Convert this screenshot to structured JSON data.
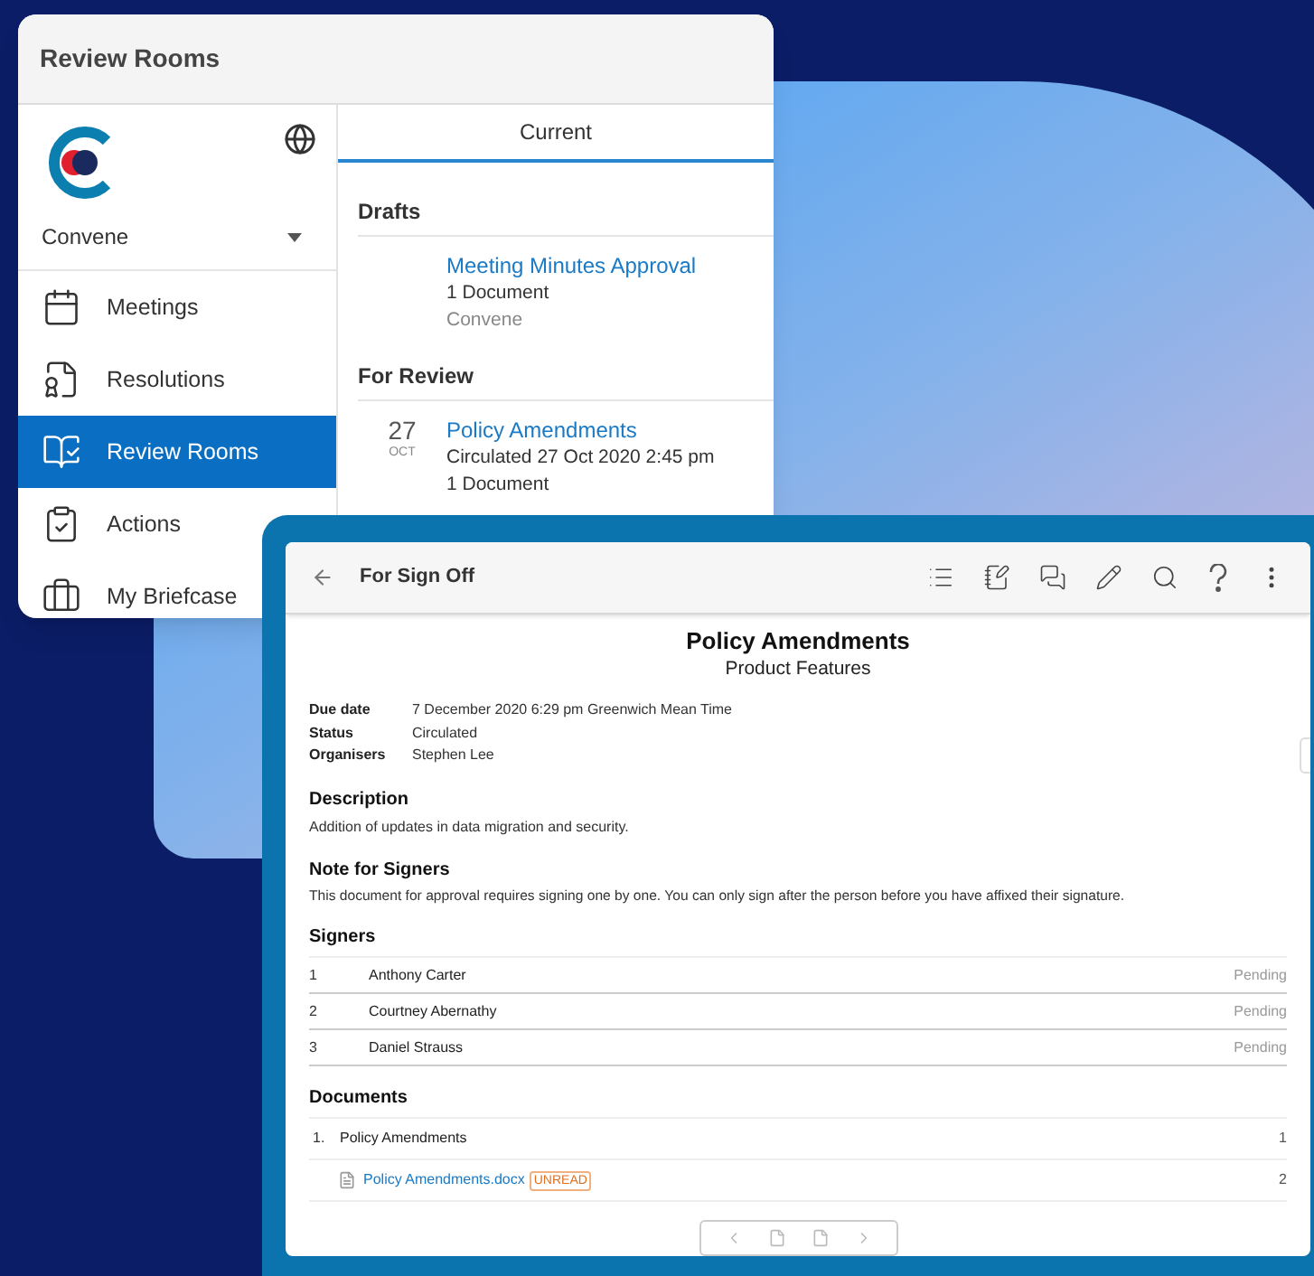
{
  "review_window": {
    "title": "Review Rooms",
    "org": "Convene",
    "nav": [
      {
        "label": "Meetings",
        "selected": false
      },
      {
        "label": "Resolutions",
        "selected": false
      },
      {
        "label": "Review Rooms",
        "selected": true
      },
      {
        "label": "Actions",
        "selected": false
      },
      {
        "label": "My Briefcase",
        "selected": false
      }
    ],
    "tabs": [
      {
        "label": "Current",
        "selected": true
      }
    ],
    "sections": [
      {
        "heading": "Drafts",
        "items": [
          {
            "title": "Meeting Minutes Approval",
            "lines": [
              {
                "text": "1 Document",
                "kind": "detail"
              },
              {
                "text": "Convene",
                "kind": "muted"
              }
            ]
          }
        ]
      },
      {
        "heading": "For Review",
        "items": [
          {
            "day": "27",
            "month": "OCT",
            "title": "Policy Amendments",
            "lines": [
              {
                "text": "Circulated 27 Oct 2020 2:45 pm",
                "kind": "detail"
              },
              {
                "text": "1 Document",
                "kind": "detail"
              }
            ]
          }
        ]
      }
    ]
  },
  "sign_off_window": {
    "title": "For Sign Off",
    "doc_title": "Policy Amendments",
    "doc_subtitle": "Product Features",
    "meta": [
      {
        "label": "Due date",
        "value": "7 December 2020 6:29 pm Greenwich Mean Time"
      },
      {
        "label": "Status",
        "value": "Circulated"
      },
      {
        "label": "Organisers",
        "value": "Stephen Lee"
      }
    ],
    "description": {
      "heading": "Description",
      "text": "Addition of updates in data migration and security."
    },
    "note": {
      "heading": "Note for Signers",
      "text": "This document for approval requires signing one by one. You can only sign after the person before you have affixed their signature."
    },
    "signers": {
      "heading": "Signers",
      "rows": [
        {
          "number": "1",
          "name": "Anthony Carter",
          "status": "Pending"
        },
        {
          "number": "2",
          "name": "Courtney Abernathy",
          "status": "Pending"
        },
        {
          "number": "3",
          "name": "Daniel Strauss",
          "status": "Pending"
        }
      ]
    },
    "documents": {
      "heading": "Documents",
      "rows": [
        {
          "kind": "section",
          "number": "1.",
          "name": "Policy Amendments",
          "page": "1"
        },
        {
          "kind": "file",
          "name": "Policy Amendments.docx",
          "badge": "UNREAD",
          "page": "2"
        }
      ]
    }
  }
}
